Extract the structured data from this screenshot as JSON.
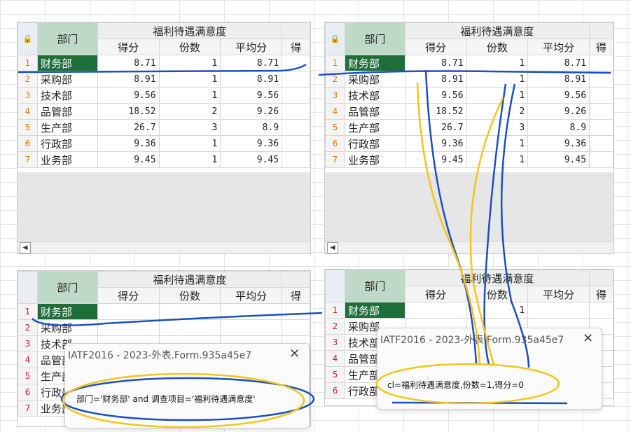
{
  "table": {
    "lock_icon": "lock-icon",
    "dept_header": "部门",
    "group_header": "福利待遇满意度",
    "sub_headers": [
      "得分",
      "份数",
      "平均分",
      "得"
    ],
    "rows": [
      {
        "n": "1",
        "dept": "财务部",
        "score": "8.71",
        "count": "1",
        "avg": "8.71"
      },
      {
        "n": "2",
        "dept": "采购部",
        "score": "8.91",
        "count": "1",
        "avg": "8.91"
      },
      {
        "n": "3",
        "dept": "技术部",
        "score": "9.56",
        "count": "1",
        "avg": "9.56"
      },
      {
        "n": "4",
        "dept": "品管部",
        "score": "18.52",
        "count": "2",
        "avg": "9.26"
      },
      {
        "n": "5",
        "dept": "生产部",
        "score": "26.7",
        "count": "3",
        "avg": "8.9"
      },
      {
        "n": "6",
        "dept": "行政部",
        "score": "9.36",
        "count": "1",
        "avg": "9.36"
      },
      {
        "n": "7",
        "dept": "业务部",
        "score": "9.45",
        "count": "1",
        "avg": "9.45"
      }
    ],
    "scroll_arrow": "◀"
  },
  "bottom_left": {
    "rows": [
      {
        "n": "1",
        "dept": "财务部"
      },
      {
        "n": "2",
        "dept": "采购部"
      },
      {
        "n": "3",
        "dept": "技术部"
      },
      {
        "n": "4",
        "dept": "品管部"
      },
      {
        "n": "5",
        "dept": "生产部"
      },
      {
        "n": "6",
        "dept": "行政部"
      },
      {
        "n": "7",
        "dept": "业务部"
      }
    ]
  },
  "bottom_right": {
    "rows": [
      {
        "n": "1",
        "dept": "财务部",
        "count": "1"
      },
      {
        "n": "2",
        "dept": "采购部",
        "count": ""
      },
      {
        "n": "3",
        "dept": "技术部",
        "count": ""
      },
      {
        "n": "4",
        "dept": "品管部",
        "count": ""
      },
      {
        "n": "5",
        "dept": "生产部",
        "count": ""
      },
      {
        "n": "6",
        "dept": "行政部",
        "count": ""
      }
    ]
  },
  "dialog_left": {
    "title": "IATF2016 - 2023-外表.Form.935a45e7",
    "close": "✕",
    "message": "部门='财务部' and 调查项目='福利待遇满意度'"
  },
  "dialog_right": {
    "title": "IATF2016 - 2023-外表.Form.935a45e7",
    "close": "✕",
    "message": "cl=福利待遇满意度,份数=1,得分=0"
  },
  "colors": {
    "selected_cell": "#1f6e3a",
    "dept_header": "#bfd9c8",
    "row_number": "#e07a10",
    "annotation_blue": "#1a4fc4",
    "annotation_yellow": "#f5c518"
  }
}
